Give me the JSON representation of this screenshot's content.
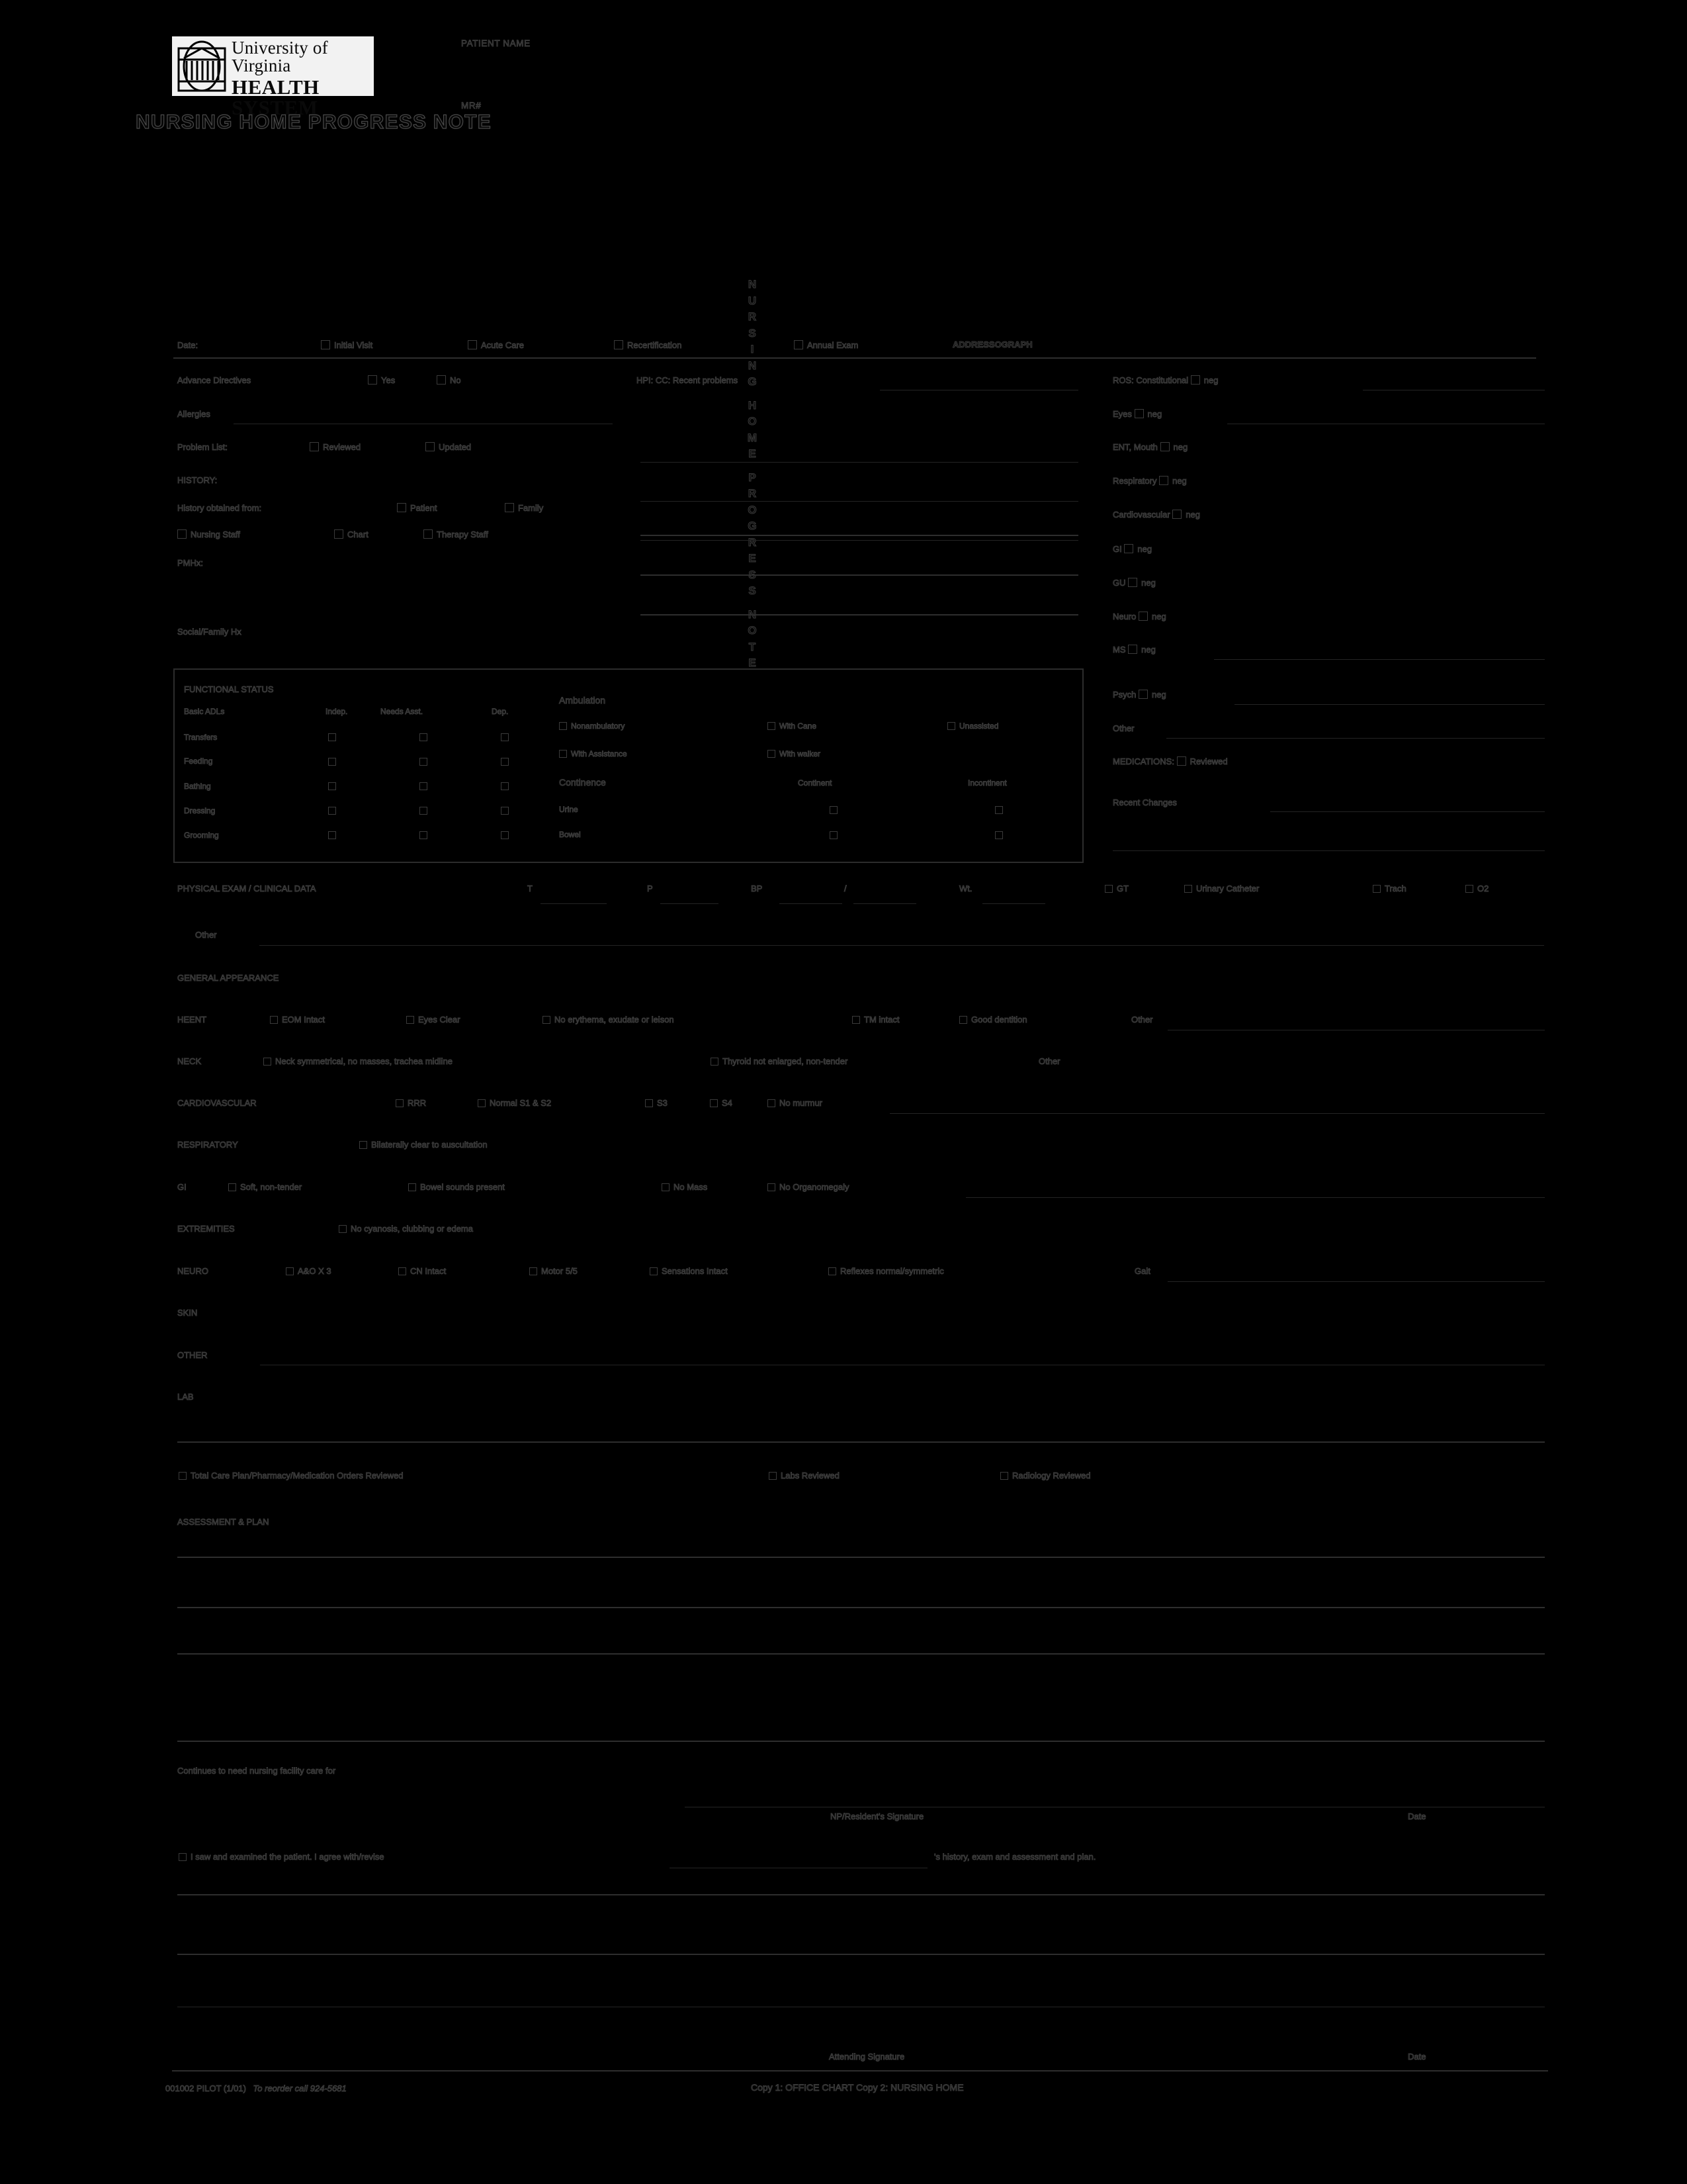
{
  "logo": {
    "line1": "University of Virginia",
    "line2": "HEALTH SYSTEM",
    "mark": "rotunda-icon"
  },
  "header": {
    "title": "NURSING HOME PROGRESS NOTE",
    "patient_name_label": "PATIENT NAME",
    "mrn_label": "MR#",
    "addressograph_label": "ADDRESSOGRAPH",
    "vertical_title": "NURSING HOME PROGRESS NOTE"
  },
  "visit_row": {
    "date_label": "Date:",
    "options": [
      "Initial Visit",
      "Acute Care",
      "Recertification",
      "Annual Exam"
    ]
  },
  "left_column": {
    "advance_directives_label": "Advance Directives",
    "advance_directives_options": [
      "Yes",
      "No"
    ],
    "allergies_label": "Allergies",
    "problem_list_label": "Problem List:",
    "problem_list_options": [
      "Reviewed",
      "Updated"
    ],
    "history_heading": "HISTORY:",
    "history_obtained_label": "History obtained from:",
    "history_sources_row1": [
      "Patient",
      "Family"
    ],
    "history_sources_row2": [
      "Nursing Staff",
      "Chart",
      "Therapy Staff"
    ],
    "pmhx_label": "PMHx:",
    "social_family_label": "Social/Family Hx"
  },
  "middle_column": {
    "hpi_label": "HPI: CC: Recent problems"
  },
  "ros": {
    "items": [
      {
        "label": "ROS: Constitutional",
        "neg": "neg",
        "rule": true
      },
      {
        "label": "Eyes",
        "neg": "neg",
        "rule": true
      },
      {
        "label": "ENT, Mouth",
        "neg": "neg",
        "rule": false
      },
      {
        "label": "Respiratory",
        "neg": "neg",
        "rule": false
      },
      {
        "label": "Cardiovascular",
        "neg": "neg",
        "rule": false
      },
      {
        "label": "GI",
        "neg": "neg",
        "rule": false
      },
      {
        "label": "GU",
        "neg": "neg",
        "rule": false
      },
      {
        "label": "Neuro",
        "neg": "neg",
        "rule": false
      },
      {
        "label": "MS",
        "neg": "neg",
        "rule": true
      },
      {
        "label": "Psych",
        "neg": "neg",
        "rule": true
      }
    ],
    "other_label": "Other",
    "medications_label": "MEDICATIONS:",
    "medications_option": "Reviewed",
    "recent_changes_label": "Recent Changes"
  },
  "functional_status": {
    "heading": "FUNCTIONAL STATUS",
    "columns": [
      "Basic ADLs",
      "Indep.",
      "Needs Asst.",
      "Dep."
    ],
    "rows": [
      "Transfers",
      "Feeding",
      "Bathing",
      "Dressing",
      "Grooming"
    ],
    "ambulation_heading": "Ambulation",
    "ambulation_options": [
      "Nonambulatory",
      "With Cane",
      "Unassisted",
      "With Assistance",
      "With walker"
    ],
    "continence_heading": "Continence",
    "continence_columns": [
      "Continent",
      "Incontinent"
    ],
    "continence_rows": [
      "Urine",
      "Bowel"
    ]
  },
  "physical_exam": {
    "heading": "PHYSICAL EXAM / CLINICAL DATA",
    "vitals": [
      "T",
      "P",
      "BP",
      "/",
      "Wt."
    ],
    "devices": [
      "GT",
      "Urinary Catheter",
      "Trach",
      "O2"
    ],
    "other_label": "Other",
    "general_appearance_label": "GENERAL APPEARANCE",
    "sections": [
      {
        "name": "HEENT",
        "options": [
          "EOM Intact",
          "Eyes Clear",
          "No erythema, exudate or leison",
          "TM intact",
          "Good dentition"
        ],
        "other": "Other",
        "has_rule": true
      },
      {
        "name": "NECK",
        "options": [
          "Neck symmetrical, no masses, trachea midline",
          "Thyroid not enlarged, non-tender"
        ],
        "other": "Other",
        "has_rule": false
      },
      {
        "name": "CARDIOVASCULAR",
        "options": [
          "RRR",
          "Normal S1 & S2",
          "S3",
          "S4",
          "No murmur"
        ],
        "other": "",
        "has_rule": true
      },
      {
        "name": "RESPIRATORY",
        "options": [
          "Bilaterally clear to auscultation"
        ],
        "other": "",
        "has_rule": false
      },
      {
        "name": "GI",
        "options": [
          "Soft, non-tender",
          "Bowel sounds present",
          "No Mass",
          "No Organomegaly"
        ],
        "other": "",
        "has_rule": true
      },
      {
        "name": "EXTREMITIES",
        "options": [
          "No cyanosis, clubbing or edema"
        ],
        "other": "",
        "has_rule": false
      },
      {
        "name": "NEURO",
        "options": [
          "A&O X 3",
          "CN Intact",
          "Motor 5/5",
          "Sensations Intact",
          "Reflexes normal/symmetric"
        ],
        "other": "Gait",
        "has_rule": true
      }
    ],
    "skin_label": "SKIN",
    "other_section_label": "OTHER",
    "lab_label": "LAB"
  },
  "review_row": {
    "options": [
      "Total Care Plan/Pharmacy/Medication Orders Reviewed",
      "Labs Reviewed",
      "Radiology Reviewed"
    ]
  },
  "assessment": {
    "heading": "ASSESSMENT & PLAN"
  },
  "footer": {
    "continues_label": "Continues to need nursing facility care for",
    "np_signature_label": "NP/Resident's Signature",
    "date_label_1": "Date",
    "attestation_pre": "I saw and examined the patient. I agree with/revise",
    "attestation_post": "'s history, exam and assessment and plan.",
    "attending_signature_label": "Attending Signature",
    "date_label_2": "Date",
    "form_number": "001002 PILOT (1/01)",
    "reorder_text": "To reorder call 924-5681",
    "copy_text": "Copy 1: OFFICE CHART    Copy 2: NURSING HOME"
  }
}
